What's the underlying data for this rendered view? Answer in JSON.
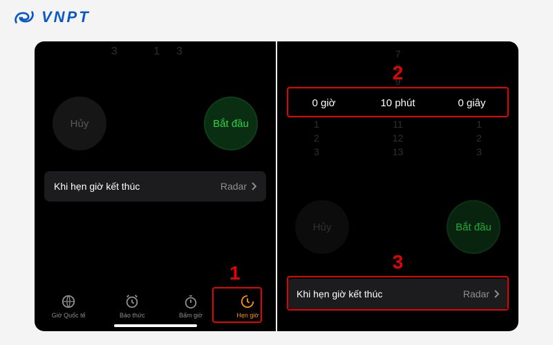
{
  "brand": {
    "name": "VNPT"
  },
  "annotations": {
    "one": "1",
    "two": "2",
    "three": "3"
  },
  "left": {
    "ghost_upper": "3   13",
    "cancel": "Hủy",
    "start": "Bắt đầu",
    "end_label": "Khi hẹn giờ kết thúc",
    "end_value": "Radar",
    "tabs": {
      "world": "Giờ Quốc tế",
      "alarm": "Báo thức",
      "stopwatch": "Bấm giờ",
      "timer": "Hẹn giờ"
    }
  },
  "right": {
    "picker": {
      "hours_val": "0",
      "hours_unit": "giờ",
      "minutes_val": "10",
      "minutes_unit": "phút",
      "seconds_val": "0",
      "seconds_unit": "giây"
    },
    "wheel_above": [
      "7",
      "8",
      "9"
    ],
    "wheel_below_h": [
      "1",
      "2",
      "3"
    ],
    "wheel_below_m": [
      "11",
      "12",
      "13"
    ],
    "wheel_below_s": [
      "1",
      "2",
      "3"
    ],
    "cancel": "Hủy",
    "start": "Bắt đầu",
    "end_label": "Khi hẹn giờ kết thúc",
    "end_value": "Radar"
  }
}
